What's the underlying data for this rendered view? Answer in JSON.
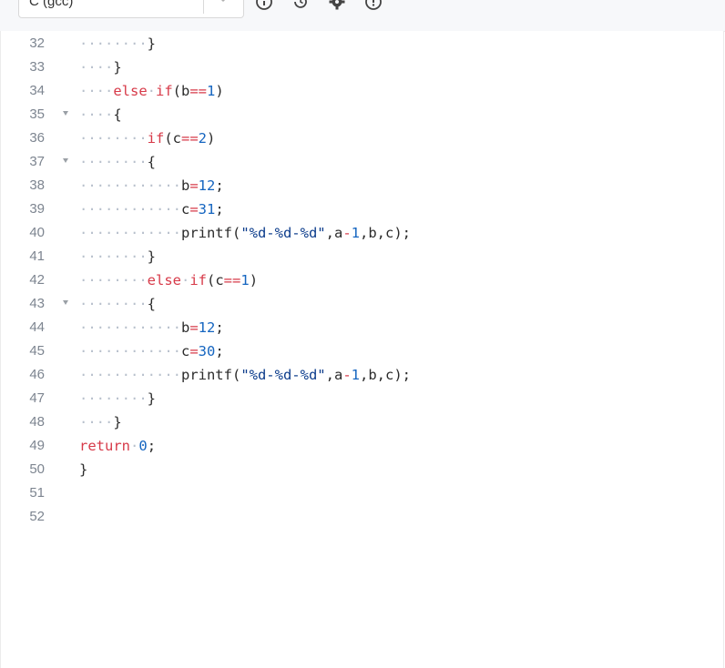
{
  "toolbar": {
    "language_label": "C (gcc)",
    "icons": [
      "info-icon",
      "reset-icon",
      "settings-icon",
      "download-icon"
    ]
  },
  "editor": {
    "lines": [
      {
        "num": "32",
        "fold": false,
        "indent": 8,
        "tokens": [
          {
            "t": "}",
            "c": "plain"
          }
        ]
      },
      {
        "num": "33",
        "fold": false,
        "indent": 4,
        "tokens": [
          {
            "t": "}",
            "c": "plain"
          }
        ]
      },
      {
        "num": "34",
        "fold": false,
        "indent": 4,
        "tokens": [
          {
            "t": "else",
            "c": "kw"
          },
          {
            "t": " ",
            "c": "ws"
          },
          {
            "t": "if",
            "c": "kw"
          },
          {
            "t": "(b",
            "c": "plain"
          },
          {
            "t": "==",
            "c": "op"
          },
          {
            "t": "1",
            "c": "num"
          },
          {
            "t": ")",
            "c": "plain"
          }
        ]
      },
      {
        "num": "35",
        "fold": true,
        "indent": 4,
        "tokens": [
          {
            "t": "{",
            "c": "plain"
          }
        ]
      },
      {
        "num": "36",
        "fold": false,
        "indent": 8,
        "tokens": [
          {
            "t": "if",
            "c": "kw"
          },
          {
            "t": "(c",
            "c": "plain"
          },
          {
            "t": "==",
            "c": "op"
          },
          {
            "t": "2",
            "c": "num"
          },
          {
            "t": ")",
            "c": "plain"
          }
        ]
      },
      {
        "num": "37",
        "fold": true,
        "indent": 8,
        "tokens": [
          {
            "t": "{",
            "c": "plain"
          }
        ]
      },
      {
        "num": "38",
        "fold": false,
        "indent": 12,
        "tokens": [
          {
            "t": "b",
            "c": "plain"
          },
          {
            "t": "=",
            "c": "op"
          },
          {
            "t": "12",
            "c": "num"
          },
          {
            "t": ";",
            "c": "plain"
          }
        ]
      },
      {
        "num": "39",
        "fold": false,
        "indent": 12,
        "tokens": [
          {
            "t": "c",
            "c": "plain"
          },
          {
            "t": "=",
            "c": "op"
          },
          {
            "t": "31",
            "c": "num"
          },
          {
            "t": ";",
            "c": "plain"
          }
        ]
      },
      {
        "num": "40",
        "fold": false,
        "indent": 12,
        "tokens": [
          {
            "t": "printf(",
            "c": "plain"
          },
          {
            "t": "\"%d-%d-%d\"",
            "c": "str"
          },
          {
            "t": ",a",
            "c": "plain"
          },
          {
            "t": "-",
            "c": "op"
          },
          {
            "t": "1",
            "c": "num"
          },
          {
            "t": ",b,c);",
            "c": "plain"
          }
        ]
      },
      {
        "num": "41",
        "fold": false,
        "indent": 8,
        "tokens": [
          {
            "t": "}",
            "c": "plain"
          }
        ]
      },
      {
        "num": "42",
        "fold": false,
        "indent": 8,
        "tokens": [
          {
            "t": "else",
            "c": "kw"
          },
          {
            "t": " ",
            "c": "ws"
          },
          {
            "t": "if",
            "c": "kw"
          },
          {
            "t": "(c",
            "c": "plain"
          },
          {
            "t": "==",
            "c": "op"
          },
          {
            "t": "1",
            "c": "num"
          },
          {
            "t": ")",
            "c": "plain"
          }
        ]
      },
      {
        "num": "43",
        "fold": true,
        "indent": 8,
        "tokens": [
          {
            "t": "{",
            "c": "plain"
          }
        ]
      },
      {
        "num": "44",
        "fold": false,
        "indent": 12,
        "tokens": [
          {
            "t": "b",
            "c": "plain"
          },
          {
            "t": "=",
            "c": "op"
          },
          {
            "t": "12",
            "c": "num"
          },
          {
            "t": ";",
            "c": "plain"
          }
        ]
      },
      {
        "num": "45",
        "fold": false,
        "indent": 12,
        "tokens": [
          {
            "t": "c",
            "c": "plain"
          },
          {
            "t": "=",
            "c": "op"
          },
          {
            "t": "30",
            "c": "num"
          },
          {
            "t": ";",
            "c": "plain"
          }
        ]
      },
      {
        "num": "46",
        "fold": false,
        "indent": 12,
        "tokens": [
          {
            "t": "printf(",
            "c": "plain"
          },
          {
            "t": "\"%d-%d-%d\"",
            "c": "str"
          },
          {
            "t": ",a",
            "c": "plain"
          },
          {
            "t": "-",
            "c": "op"
          },
          {
            "t": "1",
            "c": "num"
          },
          {
            "t": ",b,c);",
            "c": "plain"
          }
        ]
      },
      {
        "num": "47",
        "fold": false,
        "indent": 8,
        "tokens": [
          {
            "t": "}",
            "c": "plain"
          }
        ]
      },
      {
        "num": "48",
        "fold": false,
        "indent": 4,
        "tokens": [
          {
            "t": "}",
            "c": "plain"
          }
        ]
      },
      {
        "num": "49",
        "fold": false,
        "indent": 0,
        "tokens": [
          {
            "t": "return",
            "c": "kw"
          },
          {
            "t": " ",
            "c": "ws"
          },
          {
            "t": "0",
            "c": "num"
          },
          {
            "t": ";",
            "c": "plain"
          }
        ]
      },
      {
        "num": "50",
        "fold": false,
        "indent": 0,
        "tokens": [
          {
            "t": "}",
            "c": "plain"
          }
        ]
      },
      {
        "num": "51",
        "fold": false,
        "indent": 0,
        "tokens": []
      },
      {
        "num": "52",
        "fold": false,
        "indent": 0,
        "tokens": []
      }
    ]
  }
}
